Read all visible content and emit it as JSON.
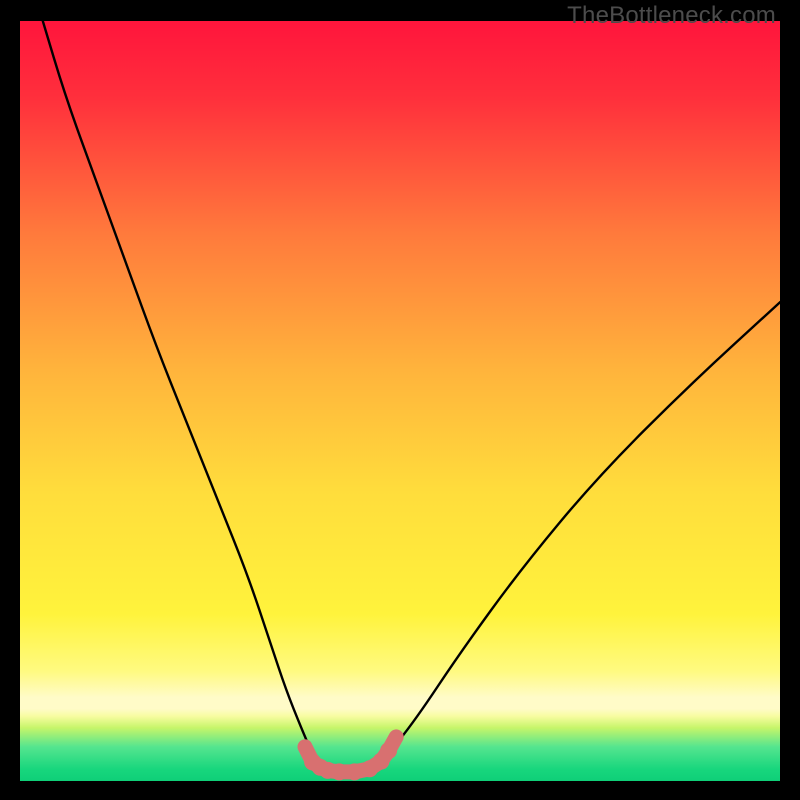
{
  "watermark": "TheBottleneck.com",
  "colors": {
    "frame": "#000000",
    "gradient_top": "#ff153c",
    "gradient_mid1": "#ff8f3c",
    "gradient_mid2": "#ffe73c",
    "gradient_band": "#fff8b8",
    "gradient_green1": "#6fe896",
    "gradient_green2": "#1fd87a",
    "curve": "#000000",
    "markers": "#d87070"
  },
  "chart_data": {
    "type": "line",
    "title": "",
    "xlabel": "",
    "ylabel": "",
    "xlim": [
      0,
      100
    ],
    "ylim": [
      0,
      100
    ],
    "series": [
      {
        "name": "bottleneck-curve",
        "x": [
          3,
          6,
          10,
          14,
          18,
          22,
          26,
          30,
          33,
          35,
          37,
          38.5,
          40,
          42,
          44,
          46,
          48,
          52,
          58,
          66,
          76,
          88,
          100
        ],
        "y": [
          100,
          90,
          79,
          68,
          57,
          47,
          37,
          27,
          18,
          12,
          7,
          3.5,
          1.5,
          1.2,
          1.2,
          1.5,
          3,
          8,
          17,
          28,
          40,
          52,
          63
        ]
      }
    ],
    "markers": {
      "name": "highlight-band",
      "x": [
        37.5,
        38.5,
        39.5,
        40.5,
        42,
        44,
        46,
        47.5,
        48.5,
        49.5
      ],
      "y": [
        4.5,
        2.5,
        1.8,
        1.4,
        1.2,
        1.2,
        1.6,
        2.6,
        4.0,
        5.8
      ]
    }
  }
}
